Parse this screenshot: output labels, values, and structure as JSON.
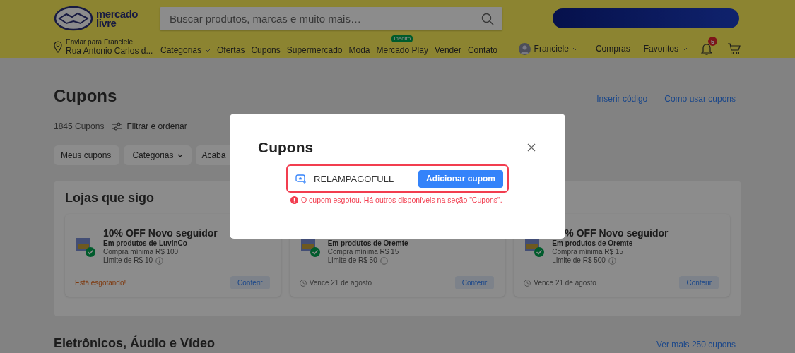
{
  "header": {
    "logo": [
      "mercado",
      "livre"
    ],
    "search": {
      "placeholder": "Buscar produtos, marcas e muito mais…"
    },
    "location": {
      "label": "Enviar para Franciele",
      "address": "Rua Antonio Carlos d..."
    },
    "nav": [
      {
        "label": "Categorias",
        "dropdown": true
      },
      {
        "label": "Ofertas",
        "dropdown": false
      },
      {
        "label": "Cupons",
        "dropdown": false
      },
      {
        "label": "Supermercado",
        "dropdown": false
      },
      {
        "label": "Moda",
        "dropdown": false
      },
      {
        "label": "Mercado Play",
        "dropdown": false,
        "badge": "Inédito"
      },
      {
        "label": "Vender",
        "dropdown": false
      },
      {
        "label": "Contato",
        "dropdown": false
      }
    ],
    "user": {
      "name": "Franciele"
    },
    "links": [
      {
        "label": "Compras",
        "dropdown": false
      },
      {
        "label": "Favoritos",
        "dropdown": true
      }
    ],
    "notifications": "5"
  },
  "page": {
    "title": "Cupons",
    "links": [
      "Inserir código",
      "Como usar cupons"
    ],
    "count": "1845 Cupons",
    "filter": "Filtrar e ordenar",
    "chips": [
      {
        "label": "Meus cupons",
        "dropdown": false
      },
      {
        "label": "Categorias",
        "dropdown": true
      },
      {
        "label": "Acaba"
      }
    ],
    "section": {
      "title": "Lojas que sigo",
      "coupons": [
        {
          "title": "10% OFF Novo seguidor",
          "store": "Em produtos de LuvinCo",
          "min": "Compra mínima R$ 100",
          "limit": "Limite de R$ 10",
          "footer": {
            "kind": "warning",
            "text": "Está esgotando!"
          },
          "button": "Conferir"
        },
        {
          "store": "Em produtos de Oremte",
          "min": "Compra mínima R$ 15",
          "limit": "Limite de R$ 50",
          "footer": {
            "kind": "expiry",
            "text": "Vence 21 de agosto"
          },
          "button": "Conferir"
        },
        {
          "title": "% OFF Novo seguidor",
          "store": "Em produtos de Oremte",
          "min": "Compra mínima R$ 15",
          "limit": "Limite de R$ 500",
          "footer": {
            "kind": "expiry",
            "text": "Vence 21 de agosto"
          },
          "button": "Conferir"
        }
      ]
    },
    "next_section": {
      "title": "Eletrônicos, Áudio e Vídeo",
      "link": "Ver mais 250 cupons"
    }
  },
  "modal": {
    "title": "Cupons",
    "code": "RELAMPAGOFULL",
    "button": "Adicionar cupom",
    "error": "O cupom esgotou. Há outros disponíveis na seção \"Cupons\"."
  }
}
